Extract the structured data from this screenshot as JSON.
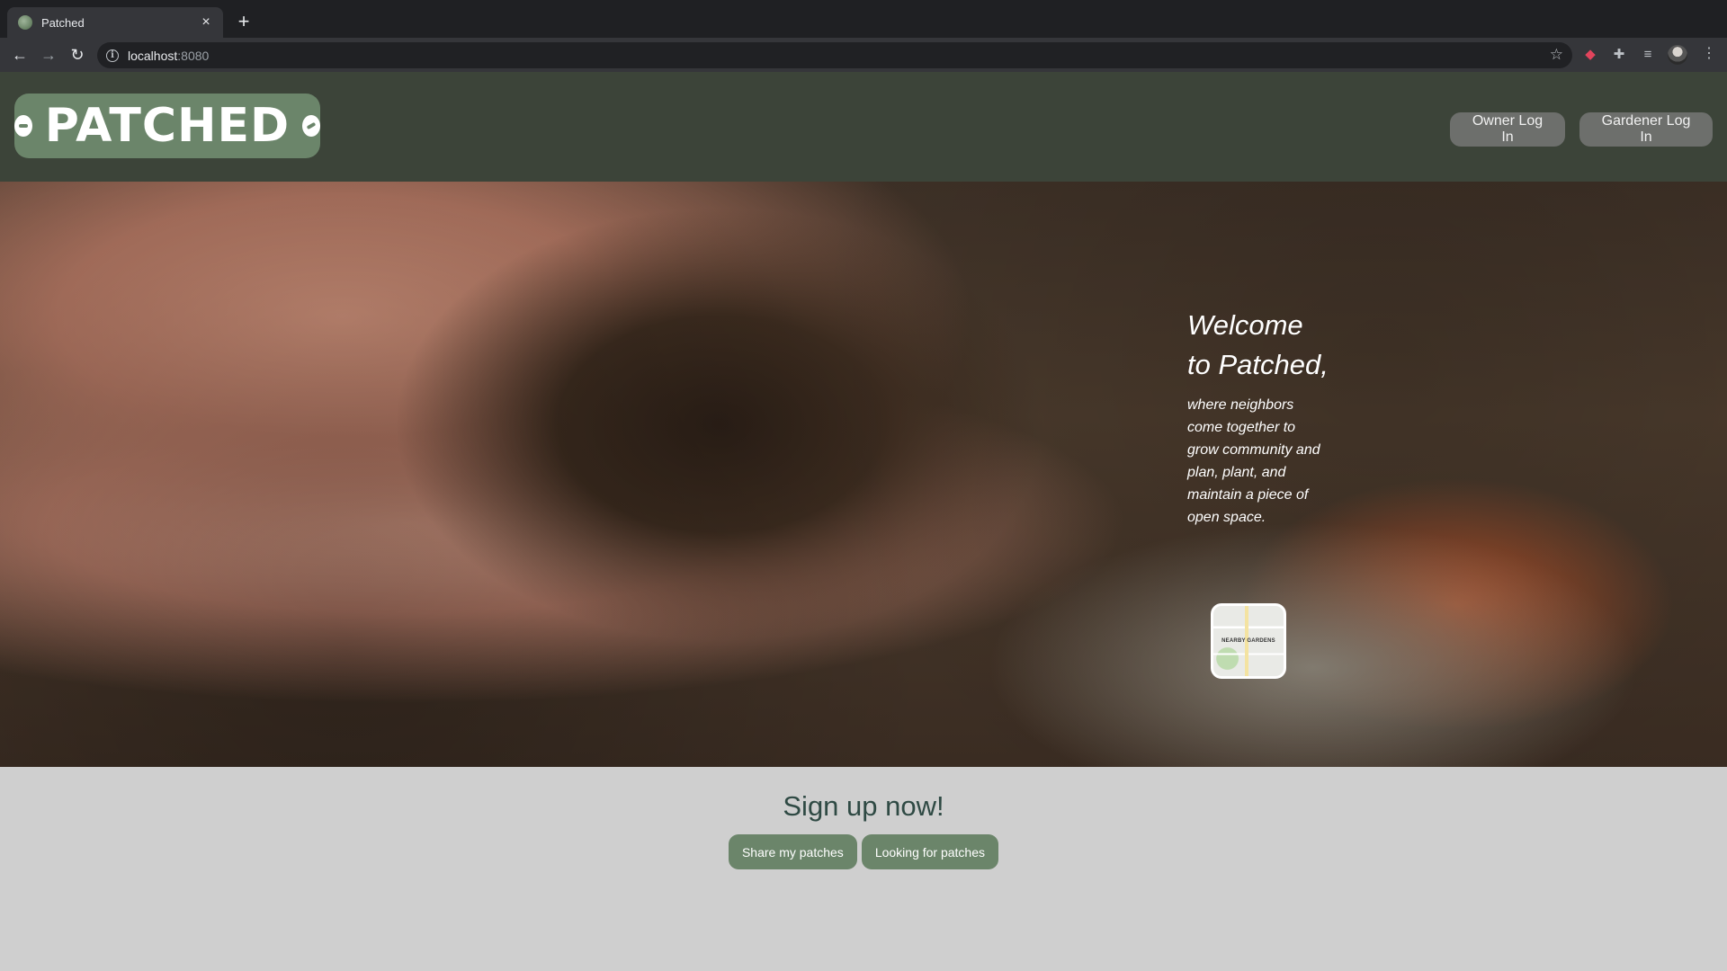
{
  "browser": {
    "tab_title": "Patched",
    "tab_close": "×",
    "new_tab": "+",
    "back": "←",
    "forward": "→",
    "reload": "↻",
    "url_host": "localhost",
    "url_port": ":8080",
    "star": "☆",
    "menu": "⋮"
  },
  "header": {
    "logo_text": "PATCHED",
    "owner_login": "Owner Log In",
    "gardener_login": "Gardener Log In"
  },
  "hero": {
    "welcome_heading": "Welcome to Patched,",
    "welcome_text": "where neighbors come together to grow community and plan, plant, and maintain a piece of open space.",
    "map_label": "NEARBY GARDENS"
  },
  "signup": {
    "heading": "Sign up now!",
    "share_button": "Share my patches",
    "looking_button": "Looking for patches"
  },
  "colors": {
    "header_bg": "#3c4439",
    "logo_green": "#6b856a",
    "button_gray": "#6d6f6c",
    "signup_bg": "#cfcfcf",
    "heading_teal": "#2f4a44"
  }
}
